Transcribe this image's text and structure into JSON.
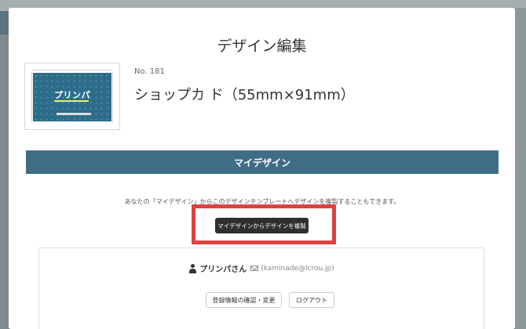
{
  "modal": {
    "title": "デザイン編集"
  },
  "product": {
    "thumbnail_logo": "プリンパ",
    "number": "No. 181",
    "name": "ショップカ ド（55mm×91mm）"
  },
  "section": {
    "title": "マイデザイン"
  },
  "info": {
    "text": "あなたの「マイデザイン」からこのデザインテンプレートへデザインを複製することもできます。"
  },
  "actions": {
    "copy_button_label": "マイデザインからデザインを複製"
  },
  "account": {
    "user_name": "プリンパさん",
    "email": "(kaminade@lcrou.jp)",
    "register_button_label": "登録情報の確認・変更",
    "logout_button_label": "ログアウト"
  },
  "colors": {
    "section_bar": "#406d86",
    "highlight_border": "#e04040",
    "copy_button_bg": "#2f2f2f"
  }
}
